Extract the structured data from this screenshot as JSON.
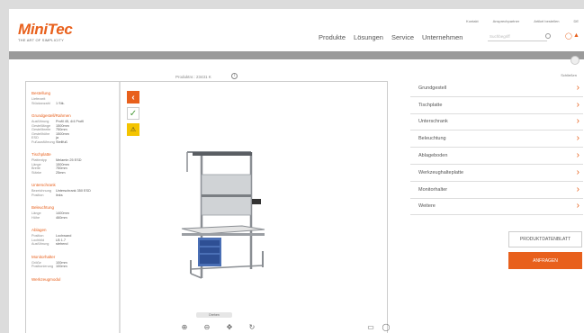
{
  "brand": {
    "name": "MiniTec",
    "tagline": "THE ART OF SIMPLICITY",
    "accent": "#e8601c"
  },
  "toplinks": [
    "Kontakt",
    "Ansprechpartner",
    "Artikel bestellen",
    "DE"
  ],
  "nav": [
    "Produkte",
    "Lösungen",
    "Service",
    "Unternehmen"
  ],
  "search": {
    "placeholder": "Suchbegriff"
  },
  "header_icons": [
    "user-icon",
    "cart-icon"
  ],
  "close_label": "Schließen",
  "produkt_nr": "Produktnr.: 23431 K",
  "left_panel": [
    {
      "title": "Bestellung",
      "rows": [
        [
          "Lieferzeit",
          ""
        ],
        [
          "Stückanzahl",
          "1 Stk."
        ]
      ]
    },
    {
      "title": "Grundgestell/Rahmen",
      "rows": [
        [
          "Ausführung",
          "Profil 45, 4/4 Profil"
        ],
        [
          "Gestelllänge",
          "1500mm"
        ],
        [
          "Gestellbreite",
          "750mm"
        ],
        [
          "Gestellhöhe",
          "1500mm"
        ],
        [
          "ESD",
          "ja"
        ],
        [
          "Fußausführung",
          "Stellfuß"
        ]
      ]
    },
    {
      "title": "Tischplatte",
      "rows": [
        [
          "Plattentyp",
          "Melamin 25 ESD"
        ],
        [
          "Länge",
          "1500mm"
        ],
        [
          "Breite",
          "750mm"
        ],
        [
          "Stärke",
          "25mm"
        ]
      ]
    },
    {
      "title": "Unterschrank",
      "rows": [
        [
          "Bezeichnung",
          "Unterschrank 350 ESD"
        ],
        [
          "Position",
          "links"
        ]
      ]
    },
    {
      "title": "Beleuchtung",
      "rows": [
        [
          "Länge",
          "1400mm"
        ],
        [
          "Höhe",
          "460mm"
        ]
      ]
    },
    {
      "title": "Ablagen",
      "rows": [
        [
          "Position",
          "Lochwand"
        ],
        [
          "Lochbild",
          "LB 1.7"
        ],
        [
          "Ausführung",
          "stehend"
        ]
      ]
    },
    {
      "title": "Monitorhalter",
      "rows": [
        [
          "Größe",
          "100mm"
        ],
        [
          "Positionierung",
          "100mm"
        ]
      ]
    },
    {
      "title": "Werkzeugmodul",
      "rows": []
    }
  ],
  "side_buttons": [
    "back-icon",
    "check-icon",
    "esd-warning-icon"
  ],
  "hint": "Drehen",
  "view_tools": [
    "zoom-in-icon",
    "zoom-out-icon",
    "pan-icon",
    "rotate-icon"
  ],
  "ar_tools": [
    "cube-icon",
    "ar-view-icon"
  ],
  "accordion": [
    "Grundgestell",
    "Tischplatte",
    "Unterschrank",
    "Beleuchtung",
    "Ablageboden",
    "Werkzeughalteplatte",
    "Monitorhalter",
    "Weitere"
  ],
  "buttons": {
    "datasheet": "PRODUKTDATENBLATT",
    "request": "ANFRAGEN"
  }
}
